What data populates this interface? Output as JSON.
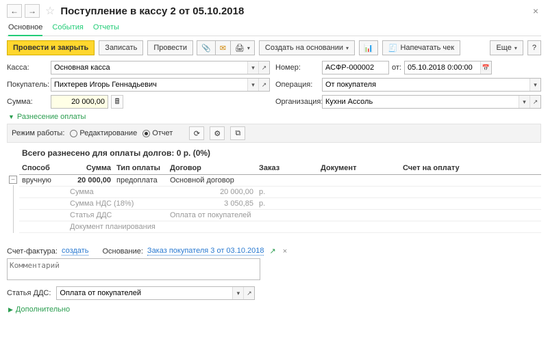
{
  "header": {
    "title": "Поступление в кассу 2 от 05.10.2018"
  },
  "tabs": [
    "Основное",
    "События",
    "Отчеты"
  ],
  "toolbar": {
    "post_close": "Провести и закрыть",
    "save": "Записать",
    "post": "Провести",
    "create_based": "Создать на основании",
    "print_receipt": "Напечатать чек",
    "more": "Еще",
    "help": "?"
  },
  "form": {
    "cash_label": "Касса:",
    "cash_value": "Основная касса",
    "number_label": "Номер:",
    "number_value": "АСФР-000002",
    "date_from": "от:",
    "date_value": "05.10.2018 0:00:00",
    "buyer_label": "Покупатель:",
    "buyer_value": "Пихтерев Игорь Геннадьевич",
    "operation_label": "Операция:",
    "operation_value": "От покупателя",
    "sum_label": "Сумма:",
    "sum_value": "20 000,00",
    "org_label": "Организация:",
    "org_value": "Кухни Ассоль"
  },
  "alloc": {
    "section_title": "Разнесение оплаты",
    "mode_label": "Режим работы:",
    "mode_edit": "Редактирование",
    "mode_report": "Отчет",
    "summary": "Всего разнесено для оплаты долгов: 0 р. (0%)",
    "cols": {
      "method": "Способ",
      "sum": "Сумма",
      "paytype": "Тип оплаты",
      "contract": "Договор",
      "order": "Заказ",
      "document": "Документ",
      "invoice": "Счет на оплату"
    },
    "row": {
      "method": "вручную",
      "sum": "20 000,00",
      "paytype": "предоплата",
      "contract": "Основной договор"
    },
    "sub": {
      "sum_label": "Сумма",
      "sum_value": "20 000,00",
      "cur1": "р.",
      "vat_label": "Сумма НДС (18%)",
      "vat_value": "3 050,85",
      "cur2": "р.",
      "dds_label": "Статья ДДС",
      "dds_value": "Оплата от покупателей",
      "plan_label": "Документ планирования"
    }
  },
  "footer": {
    "invoice_label": "Счет-фактура:",
    "invoice_action": "создать",
    "basis_label": "Основание:",
    "basis_value": "Заказ покупателя 3 от 03.10.2018",
    "comment_placeholder": "Комментарий",
    "dds_label": "Статья ДДС:",
    "dds_value": "Оплата от покупателей",
    "additional": "Дополнительно"
  }
}
